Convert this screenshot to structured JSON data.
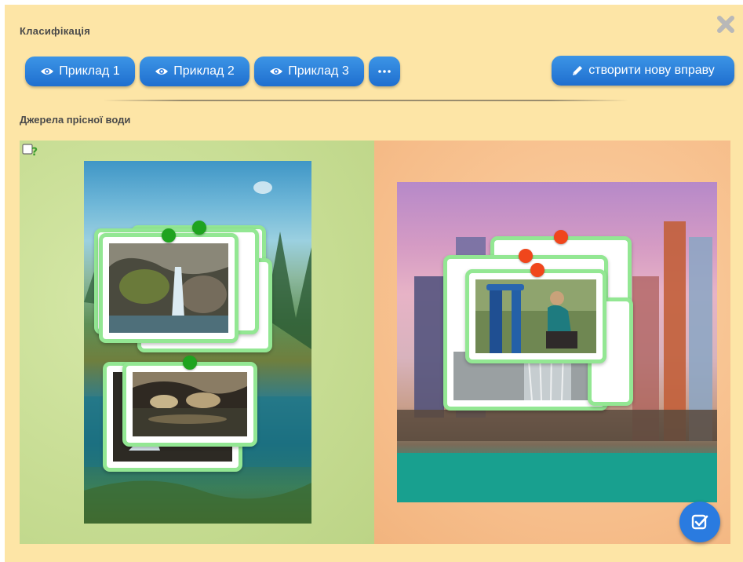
{
  "app": {
    "title": "Класифікація"
  },
  "toolbar": {
    "examples": [
      {
        "label": "Приклад 1",
        "icon": "eye-icon"
      },
      {
        "label": "Приклад 2",
        "icon": "eye-icon"
      },
      {
        "label": "Приклад 3",
        "icon": "eye-icon"
      }
    ],
    "more_icon": "ellipsis-icon",
    "create_label": "створити нову вправу",
    "create_icon": "pencil-icon"
  },
  "exercise": {
    "title": "Джерела прісної води",
    "categories": [
      {
        "id": "nature",
        "image": "forest-lake-waterfall"
      },
      {
        "id": "city",
        "image": "city-skyline-river"
      }
    ],
    "cards": [
      {
        "category": "nature",
        "image": "waterfall-rocks",
        "pin_color": "#1fa31f"
      },
      {
        "category": "nature",
        "image": "cave-water",
        "pin_color": "#1fa31f"
      },
      {
        "category": "city",
        "image": "woman-at-water-pump",
        "pin_color": "#f0461c"
      },
      {
        "category": "city",
        "image": "fountain-wall",
        "pin_color": "#f0461c"
      }
    ]
  },
  "colors": {
    "panel_bg": "#fde5a6",
    "button_blue": "#2a7be0",
    "left_zone": "#c6dc92",
    "right_zone": "#f6bd8a",
    "card_border": "#93e793",
    "pin_correct": "#1fa31f",
    "pin_wrong": "#f0461c"
  },
  "icons": {
    "close": "close-icon",
    "help": "help-icon",
    "submit": "check-square-icon"
  }
}
